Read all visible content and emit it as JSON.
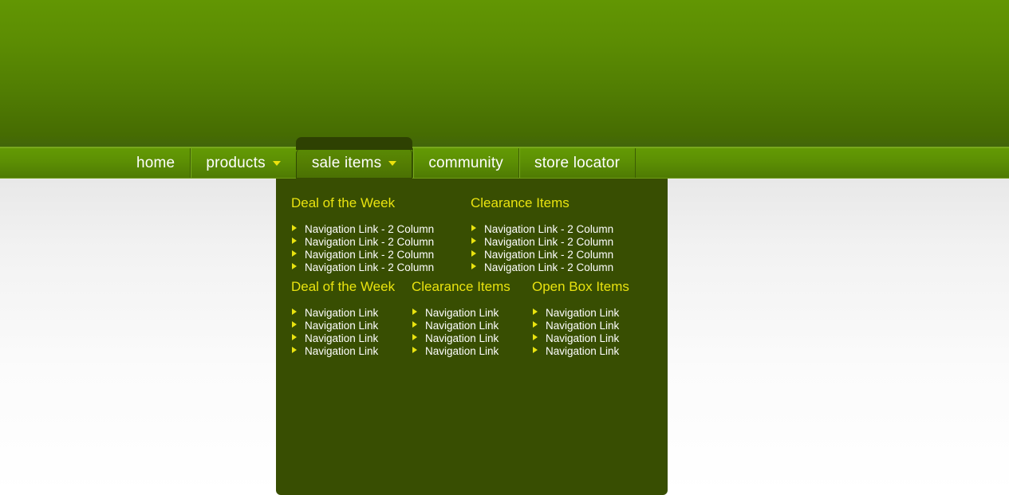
{
  "site": {
    "masthead_label": "site-masthead-banner"
  },
  "nav": {
    "items": [
      {
        "label": "home",
        "has_caret": false,
        "active": false
      },
      {
        "label": "products",
        "has_caret": true,
        "active": false
      },
      {
        "label": "sale items",
        "has_caret": true,
        "active": true
      },
      {
        "label": "community",
        "has_caret": false,
        "active": false
      },
      {
        "label": "store locator",
        "has_caret": false,
        "active": false
      }
    ]
  },
  "dropdown": {
    "owner": "sale items",
    "two_column": {
      "columns": [
        {
          "heading": "Deal of the Week",
          "links": [
            "Navigation Link - 2 Column",
            "Navigation Link - 2 Column",
            "Navigation Link - 2 Column",
            "Navigation Link - 2 Column"
          ]
        },
        {
          "heading": "Clearance Items",
          "links": [
            "Navigation Link - 2 Column",
            "Navigation Link - 2 Column",
            "Navigation Link - 2 Column",
            "Navigation Link - 2 Column"
          ]
        }
      ]
    },
    "three_column": {
      "columns": [
        {
          "heading": "Deal of the Week",
          "links": [
            "Navigation Link",
            "Navigation Link",
            "Navigation Link",
            "Navigation Link"
          ]
        },
        {
          "heading": "Clearance Items",
          "links": [
            "Navigation Link",
            "Navigation Link",
            "Navigation Link",
            "Navigation Link"
          ]
        },
        {
          "heading": "Open Box Items",
          "links": [
            "Navigation Link",
            "Navigation Link",
            "Navigation Link",
            "Navigation Link"
          ]
        }
      ]
    }
  },
  "colors": {
    "masthead_top": "#629603",
    "masthead_bottom": "#42650a",
    "nav_green": "#5d9004",
    "nav_top_border": "#77a81c",
    "dropdown_bg": "#384e02",
    "heading_yellow": "#e9e30f",
    "link_white": "#ffffff",
    "active_tab_dark": "#2e4102"
  }
}
